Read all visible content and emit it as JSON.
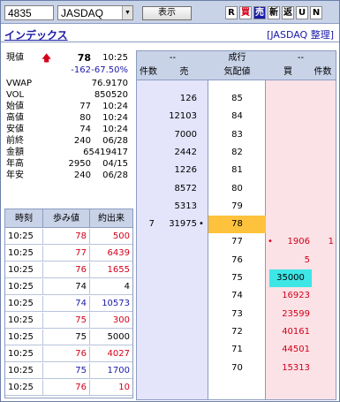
{
  "toolbar": {
    "code": "4835",
    "market": "JASDAQ",
    "show_label": "表示",
    "buttons": [
      "R",
      "買",
      "売",
      "新",
      "返",
      "U",
      "N"
    ]
  },
  "header": {
    "index_link": "インデックス",
    "market_label": "[JASDAQ 整理]"
  },
  "info": {
    "current_label": "現値",
    "current_value": "78",
    "current_time": "10:25",
    "change": "-162",
    "change_pct": "-67.50%",
    "rows": [
      {
        "label": "VWAP",
        "value": "76.9170",
        "time": ""
      },
      {
        "label": "VOL",
        "value": "850520",
        "time": ""
      },
      {
        "label": "始値",
        "value": "77",
        "time": "10:24"
      },
      {
        "label": "高値",
        "value": "80",
        "time": "10:24"
      },
      {
        "label": "安値",
        "value": "74",
        "time": "10:24"
      },
      {
        "label": "前終",
        "value": "240",
        "time": "06/28"
      },
      {
        "label": "金額",
        "value": "65419417",
        "time": ""
      },
      {
        "label": "年高",
        "value": "2950",
        "time": "04/15"
      },
      {
        "label": "年安",
        "value": "240",
        "time": "06/28"
      }
    ]
  },
  "trades": {
    "headers": [
      "時刻",
      "歩み値",
      "約出来"
    ],
    "rows": [
      {
        "time": "10:25",
        "price": "78",
        "qty": "500",
        "color": "#d4001a"
      },
      {
        "time": "10:25",
        "price": "77",
        "qty": "6439",
        "color": "#d4001a"
      },
      {
        "time": "10:25",
        "price": "76",
        "qty": "1655",
        "color": "#d4001a"
      },
      {
        "time": "10:25",
        "price": "74",
        "qty": "4",
        "color": "#000000"
      },
      {
        "time": "10:25",
        "price": "74",
        "qty": "10573",
        "color": "#1a1aa8"
      },
      {
        "time": "10:25",
        "price": "75",
        "qty": "300",
        "color": "#d4001a"
      },
      {
        "time": "10:25",
        "price": "75",
        "qty": "5000",
        "color": "#000000"
      },
      {
        "time": "10:25",
        "price": "76",
        "qty": "4027",
        "color": "#d4001a"
      },
      {
        "time": "10:25",
        "price": "75",
        "qty": "1700",
        "color": "#1a1aa8"
      },
      {
        "time": "10:25",
        "price": "76",
        "qty": "10",
        "color": "#d4001a"
      }
    ]
  },
  "board": {
    "head_sell_top": "--",
    "head_price_top": "成行",
    "head_buy_top": "--",
    "head_cnt_sell": "件数",
    "head_sell": "売",
    "head_price": "気配値",
    "head_buy": "買",
    "head_cnt_buy": "件数",
    "rows": [
      {
        "cnt_sell": "",
        "qty_sell": "126",
        "dot_sell": "",
        "price": "85",
        "dot_buy": "",
        "qty_buy": "",
        "cnt_buy": ""
      },
      {
        "cnt_sell": "",
        "qty_sell": "12103",
        "dot_sell": "",
        "price": "84",
        "dot_buy": "",
        "qty_buy": "",
        "cnt_buy": ""
      },
      {
        "cnt_sell": "",
        "qty_sell": "7000",
        "dot_sell": "",
        "price": "83",
        "dot_buy": "",
        "qty_buy": "",
        "cnt_buy": ""
      },
      {
        "cnt_sell": "",
        "qty_sell": "2442",
        "dot_sell": "",
        "price": "82",
        "dot_buy": "",
        "qty_buy": "",
        "cnt_buy": ""
      },
      {
        "cnt_sell": "",
        "qty_sell": "1226",
        "dot_sell": "",
        "price": "81",
        "dot_buy": "",
        "qty_buy": "",
        "cnt_buy": ""
      },
      {
        "cnt_sell": "",
        "qty_sell": "8572",
        "dot_sell": "",
        "price": "80",
        "dot_buy": "",
        "qty_buy": "",
        "cnt_buy": ""
      },
      {
        "cnt_sell": "",
        "qty_sell": "5313",
        "dot_sell": "",
        "price": "79",
        "dot_buy": "",
        "qty_buy": "",
        "cnt_buy": ""
      },
      {
        "cnt_sell": "7",
        "qty_sell": "31975",
        "dot_sell": "•",
        "price": "78",
        "dot_buy": "",
        "qty_buy": "",
        "cnt_buy": "",
        "hl_price": true
      },
      {
        "cnt_sell": "",
        "qty_sell": "",
        "dot_sell": "",
        "price": "77",
        "dot_buy": "•",
        "qty_buy": "1906",
        "cnt_buy": "1"
      },
      {
        "cnt_sell": "",
        "qty_sell": "",
        "dot_sell": "",
        "price": "76",
        "dot_buy": "",
        "qty_buy": "5",
        "cnt_buy": ""
      },
      {
        "cnt_sell": "",
        "qty_sell": "",
        "dot_sell": "",
        "price": "75",
        "dot_buy": "",
        "qty_buy": "35000",
        "cnt_buy": "",
        "hl_qty": true
      },
      {
        "cnt_sell": "",
        "qty_sell": "",
        "dot_sell": "",
        "price": "74",
        "dot_buy": "",
        "qty_buy": "16923",
        "cnt_buy": ""
      },
      {
        "cnt_sell": "",
        "qty_sell": "",
        "dot_sell": "",
        "price": "73",
        "dot_buy": "",
        "qty_buy": "23599",
        "cnt_buy": ""
      },
      {
        "cnt_sell": "",
        "qty_sell": "",
        "dot_sell": "",
        "price": "72",
        "dot_buy": "",
        "qty_buy": "40161",
        "cnt_buy": ""
      },
      {
        "cnt_sell": "",
        "qty_sell": "",
        "dot_sell": "",
        "price": "71",
        "dot_buy": "",
        "qty_buy": "44501",
        "cnt_buy": ""
      },
      {
        "cnt_sell": "",
        "qty_sell": "",
        "dot_sell": "",
        "price": "70",
        "dot_buy": "",
        "qty_buy": "15313",
        "cnt_buy": ""
      }
    ]
  },
  "colors": {
    "up_arrow": "#d4001a",
    "price_highlight": "#ffc23d",
    "qty_highlight": "#3fe6e6"
  }
}
